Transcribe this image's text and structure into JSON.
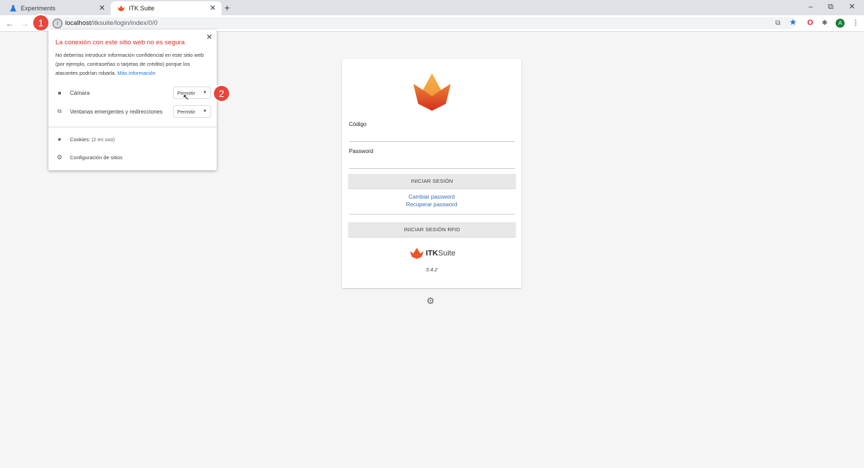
{
  "browser": {
    "tabs": [
      {
        "title": "Experiments",
        "active": false
      },
      {
        "title": "ITK Suite",
        "active": true
      }
    ],
    "new_tab": "+",
    "window_controls": {
      "minimize": "–",
      "restore": "⧉",
      "close": "✕"
    },
    "url_host": "localhost",
    "url_path": "/itksuite/login/index/0/0",
    "profile_initial": "A"
  },
  "badges": [
    "1",
    "2"
  ],
  "site_info": {
    "title": "La conexión con este sitio web no es segura",
    "description": "No deberías introducir información confidencial en este sitio web (por ejemplo, contraseñas o tarjetas de crédito) porque los atacantes podrían robarla.",
    "more_info": "Más información",
    "permissions": [
      {
        "label": "Cámara",
        "value": "Permitir",
        "icon": "camera-icon"
      },
      {
        "label": "Ventanas emergentes y redirecciones",
        "value": "Permitir",
        "icon": "popup-icon"
      }
    ],
    "cookies_label": "Cookies:",
    "cookies_count": "(2 en uso)",
    "site_settings": "Configuración de sitios"
  },
  "login": {
    "code_label": "Código",
    "password_label": "Password",
    "login_button": "INICIAR SESIÓN",
    "change_password": "Cambiar password",
    "recover_password": "Recuperar password",
    "rfid_button": "INICIAR SESIÓN RFID",
    "brand_bold": "ITK",
    "brand_rest": "Suite",
    "version": "3.4.2"
  },
  "colors": {
    "accent": "#e8453c",
    "logo_orange": "#f08a24",
    "logo_red": "#d83a1e",
    "link": "#3b6db3"
  }
}
